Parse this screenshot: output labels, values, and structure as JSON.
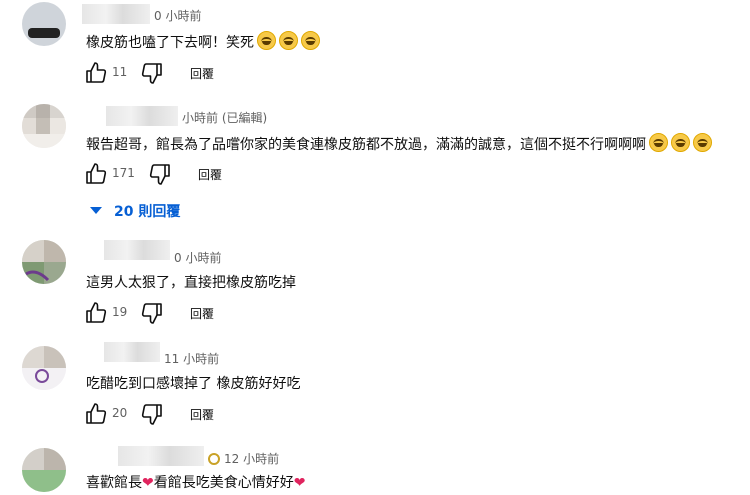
{
  "comments": [
    {
      "time": "0 小時前",
      "text": "橡皮筋也嗑了下去啊！笑死",
      "emoji": [
        "grinning-sweat-emoji",
        "grinning-sweat-emoji",
        "grinning-sweat-emoji"
      ],
      "likes": "11",
      "reply_label": "回覆"
    },
    {
      "time": "小時前 (已編輯)",
      "text": "報告超哥，館長為了品嚐你家的美食連橡皮筋都不放過，滿滿的誠意，這個不挺不行啊啊啊",
      "emoji": [
        "grinning-sweat-emoji",
        "grinning-sweat-emoji",
        "grinning-sweat-emoji"
      ],
      "likes": "171",
      "reply_label": "回覆",
      "replies_label": "20 則回覆"
    },
    {
      "time": "0 小時前",
      "text": "這男人太狠了，直接把橡皮筋吃掉",
      "likes": "19",
      "reply_label": "回覆"
    },
    {
      "time": "11 小時前",
      "text": "吃醋吃到口感壞掉了 橡皮筋好好吃",
      "likes": "20",
      "reply_label": "回覆"
    },
    {
      "time": "12 小時前",
      "text_a": "喜歡館長",
      "text_b": "看館長吃美食心情好好",
      "badge_icon": "membership-badge-icon"
    }
  ],
  "colors": {
    "link": "#065fd4",
    "meta": "#606060",
    "text": "#0f0f0f",
    "heart": "#e0245e"
  }
}
